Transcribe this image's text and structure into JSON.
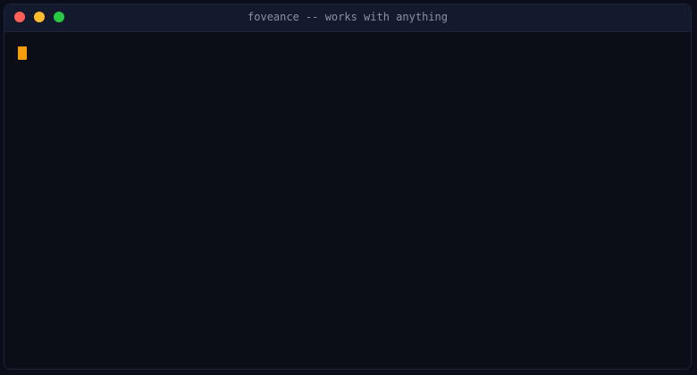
{
  "window": {
    "title": "foveance -- works with anything"
  },
  "traffic_lights": [
    {
      "name": "close",
      "color": "#ff5f57"
    },
    {
      "name": "minimize",
      "color": "#febc2e"
    },
    {
      "name": "maximize",
      "color": "#28c840"
    }
  ],
  "terminal": {
    "cursor_color": "#f59e0b"
  }
}
